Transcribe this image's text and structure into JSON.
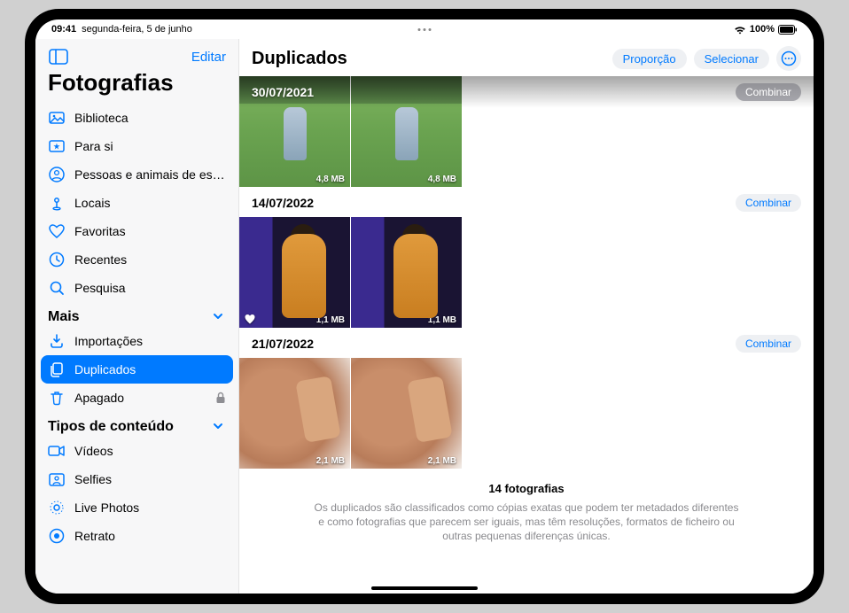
{
  "status": {
    "time": "09:41",
    "date": "segunda-feira, 5 de junho",
    "battery": "100%"
  },
  "sidebar": {
    "edit": "Editar",
    "title": "Fotografias",
    "items": [
      {
        "label": "Biblioteca"
      },
      {
        "label": "Para si"
      },
      {
        "label": "Pessoas e animais de estim…"
      },
      {
        "label": "Locais"
      },
      {
        "label": "Favoritas"
      },
      {
        "label": "Recentes"
      },
      {
        "label": "Pesquisa"
      }
    ],
    "sections": {
      "more": {
        "title": "Mais",
        "items": [
          {
            "label": "Importações"
          },
          {
            "label": "Duplicados"
          },
          {
            "label": "Apagado"
          }
        ]
      },
      "types": {
        "title": "Tipos de conteúdo",
        "items": [
          {
            "label": "Vídeos"
          },
          {
            "label": "Selfies"
          },
          {
            "label": "Live Photos"
          },
          {
            "label": "Retrato"
          }
        ]
      }
    }
  },
  "main": {
    "title": "Duplicados",
    "aspect": "Proporção",
    "select": "Selecionar",
    "groups": [
      {
        "date": "30/07/2021",
        "merge": "Combinar",
        "photos": [
          {
            "size": "4,8 MB",
            "favorite": false
          },
          {
            "size": "4,8 MB",
            "favorite": false
          }
        ]
      },
      {
        "date": "14/07/2022",
        "merge": "Combinar",
        "photos": [
          {
            "size": "1,1 MB",
            "favorite": true
          },
          {
            "size": "1,1 MB",
            "favorite": false
          }
        ]
      },
      {
        "date": "21/07/2022",
        "merge": "Combinar",
        "photos": [
          {
            "size": "2,1 MB",
            "favorite": false
          },
          {
            "size": "2,1 MB",
            "favorite": false
          }
        ]
      }
    ],
    "footer": {
      "count": "14 fotografias",
      "note": "Os duplicados são classificados como cópias exatas que podem ter metadados diferentes e como fotografias que parecem ser iguais, mas têm resoluções, formatos de ficheiro ou outras pequenas diferenças únicas."
    }
  }
}
